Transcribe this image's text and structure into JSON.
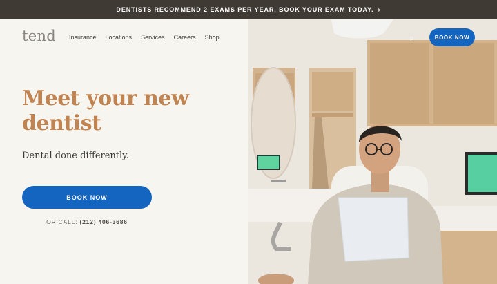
{
  "banner": {
    "text": "DENTISTS RECOMMEND 2 EXAMS PER YEAR. BOOK YOUR EXAM TODAY.",
    "chevron": "›"
  },
  "header": {
    "logo": "tend",
    "nav": [
      "Insurance",
      "Locations",
      "Services",
      "Careers",
      "Shop"
    ],
    "faded_link": "p",
    "book_button": "BOOK NOW"
  },
  "hero": {
    "title": "Meet your new dentist",
    "subtitle": "Dental done differently.",
    "book_button": "BOOK NOW",
    "call_prefix": "OR CALL:",
    "phone": "(212) 406-3686",
    "image": "dentist-office-patient-photo"
  },
  "colors": {
    "banner": "#403a35",
    "accent_title": "#c08352",
    "button": "#1465c0",
    "background": "#f7f5f0"
  }
}
